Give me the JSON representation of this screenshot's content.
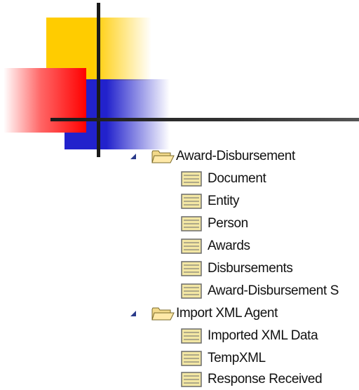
{
  "tree": {
    "groups": [
      {
        "label": "Award-Disbursement",
        "expanded": true,
        "icon": "open-folder-icon",
        "children": [
          {
            "label": "Document",
            "icon": "table-icon"
          },
          {
            "label": "Entity",
            "icon": "table-icon"
          },
          {
            "label": "Person",
            "icon": "table-icon"
          },
          {
            "label": "Awards",
            "icon": "table-icon"
          },
          {
            "label": "Disbursements",
            "icon": "table-icon"
          },
          {
            "label": "Award-Disbursement S",
            "icon": "table-icon"
          }
        ]
      },
      {
        "label": "Import XML Agent",
        "expanded": true,
        "icon": "open-folder-icon",
        "children": [
          {
            "label": "Imported XML Data",
            "icon": "table-icon"
          },
          {
            "label": "TempXML",
            "icon": "table-icon"
          },
          {
            "label": "Response Received",
            "icon": "table-icon"
          }
        ]
      }
    ]
  },
  "colors": {
    "yellow": "#ffcc00",
    "red": "#ff0000",
    "blue": "#2222cc",
    "line": "#1a1a1a",
    "folder": "#f2d98a",
    "table_fill": "#f3e7a4",
    "table_border": "#6b6b6b"
  }
}
